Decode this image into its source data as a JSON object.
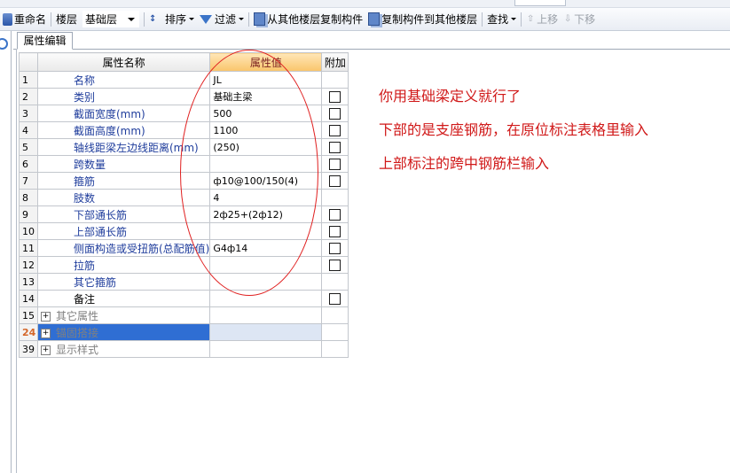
{
  "toolbar": {
    "rename_label": "重命名",
    "floor_label": "楼层",
    "floor_value": "基础层",
    "sort_label": "排序",
    "filter_label": "过滤",
    "copy_from_label": "从其他楼层复制构件",
    "copy_to_label": "复制构件到其他楼层",
    "find_label": "查找",
    "move_up_label": "上移",
    "move_down_label": "下移"
  },
  "panel": {
    "tab_label": "属性编辑"
  },
  "grid": {
    "headers": {
      "name": "属性名称",
      "value": "属性值",
      "add": "附加"
    },
    "rows": [
      {
        "no": "1",
        "name": "名称",
        "value": "JL",
        "check": false
      },
      {
        "no": "2",
        "name": "类别",
        "value": "基础主梁",
        "check": true
      },
      {
        "no": "3",
        "name": "截面宽度(mm)",
        "value": "500",
        "check": true
      },
      {
        "no": "4",
        "name": "截面高度(mm)",
        "value": "1100",
        "check": true
      },
      {
        "no": "5",
        "name": "轴线距梁左边线距离(mm)",
        "value": "(250)",
        "check": true
      },
      {
        "no": "6",
        "name": "跨数量",
        "value": "",
        "check": true
      },
      {
        "no": "7",
        "name": "箍筋",
        "value": "ф10@100/150(4)",
        "check": true
      },
      {
        "no": "8",
        "name": "肢数",
        "value": "4",
        "check": false
      },
      {
        "no": "9",
        "name": "下部通长筋",
        "value": "2ф25+(2ф12)",
        "check": true
      },
      {
        "no": "10",
        "name": "上部通长筋",
        "value": "",
        "check": true
      },
      {
        "no": "11",
        "name": "侧面构造或受扭筋(总配筋值)",
        "value": "G4ф14",
        "check": true
      },
      {
        "no": "12",
        "name": "拉筋",
        "value": "",
        "check": true
      },
      {
        "no": "13",
        "name": "其它箍筋",
        "value": "",
        "check": false
      },
      {
        "no": "14",
        "name": "备注",
        "value": "",
        "check": true
      },
      {
        "no": "15",
        "name": "其它属性",
        "value": "",
        "check": false
      },
      {
        "no": "24",
        "name": "锚固搭接",
        "value": "",
        "check": false
      },
      {
        "no": "39",
        "name": "显示样式",
        "value": "",
        "check": false
      }
    ]
  },
  "annotation": {
    "line1": "你用基础梁定义就行了",
    "line2": "下部的是支座钢筋，在原位标注表格里输入",
    "line3": "上部标注的跨中钢筋栏输入"
  }
}
